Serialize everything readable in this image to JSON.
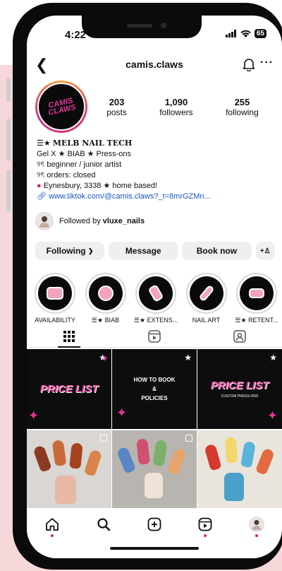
{
  "status": {
    "time": "4:22",
    "battery": "65"
  },
  "header": {
    "username": "camis.claws",
    "more": "···"
  },
  "profile": {
    "avatar_text": "CAMIS CLAWS",
    "stats": [
      {
        "value": "203",
        "label": "posts"
      },
      {
        "value": "1,090",
        "label": "followers"
      },
      {
        "value": "255",
        "label": "following"
      }
    ],
    "bio": {
      "name": "MELB NAIL TECH",
      "line1": "Gel X ★ BIAB ★ Press-ons",
      "line2": "୨ৎ beginner / junior artist",
      "line3": "୨ৎ orders: closed",
      "line4": "Eynesbury, 3338 ★ home based!",
      "link": "www.tiktok.com/@camis.claws?_t=8mrGZMn..."
    },
    "followed_by_prefix": "Followed by ",
    "followed_by_user": "vluxe_nails"
  },
  "buttons": {
    "following": "Following",
    "message": "Message",
    "book": "Book now",
    "add_user": "+♙"
  },
  "highlights": [
    {
      "label": "AVAILABILITY"
    },
    {
      "label": "BIAB"
    },
    {
      "label": "EXTENS..."
    },
    {
      "label": "NAIL ART"
    },
    {
      "label": "RETENT..."
    }
  ],
  "posts": {
    "tile1": "PRICE LIST",
    "tile2_line1": "HOW TO BOOK",
    "tile2_line2": "&",
    "tile2_line3": "POLICIES",
    "tile3": "PRICE LIST",
    "tile3_sub": "CUSTOM PRESS-ONS"
  },
  "colors": {
    "accent": "#e0359a",
    "link": "#1a56c5",
    "notification": "#e0245e"
  }
}
